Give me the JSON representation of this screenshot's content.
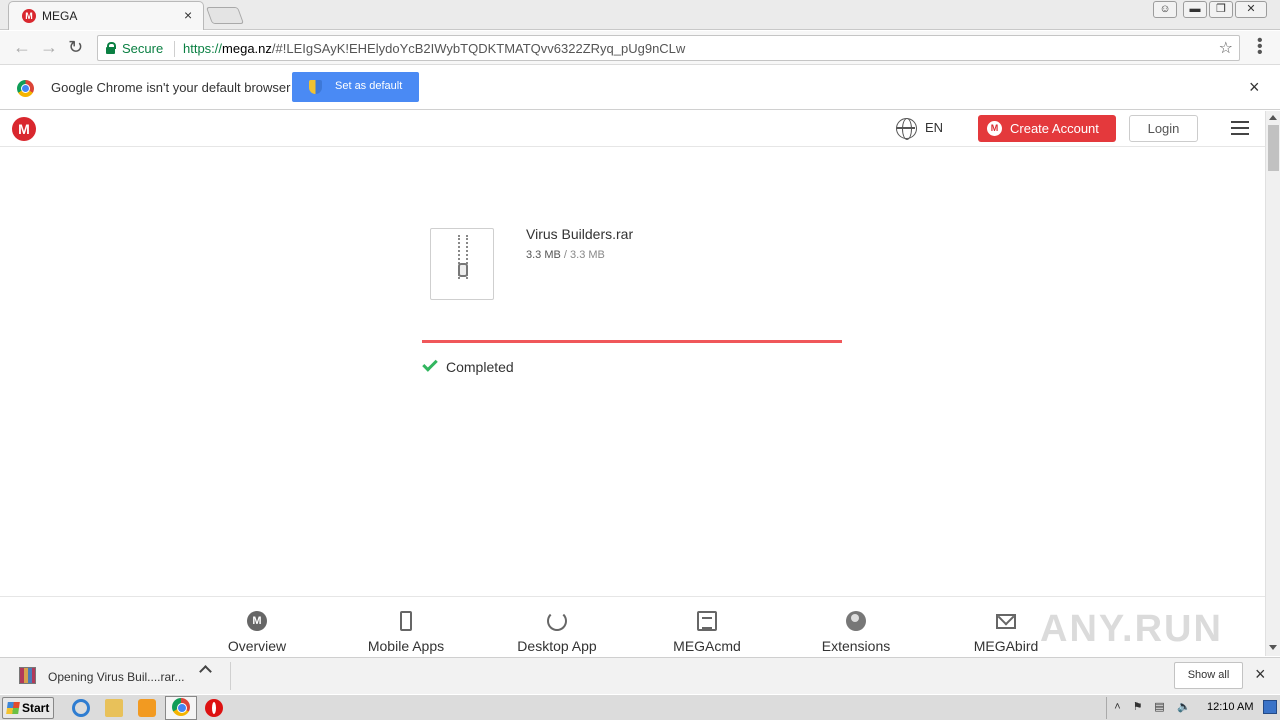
{
  "browser": {
    "tab_title": "MEGA",
    "tab_close": "×",
    "favicon_letter": "M",
    "secure_label": "Secure",
    "url_scheme": "https://",
    "url_host": "mega.nz",
    "url_rest": "/#!LEIgSAyK!EHElydoYcB2IWybTQDKTMATQvv6322ZRyq_pUg9nCLw",
    "window_controls": [
      "user",
      "minimize",
      "restore",
      "close"
    ]
  },
  "infobar": {
    "message": "Google Chrome isn't your default browser",
    "set_default_label": "Set as default",
    "close": "×"
  },
  "mega": {
    "logo_letter": "M",
    "language": "EN",
    "create_account_label": "Create Account",
    "login_label": "Login",
    "file": {
      "name": "Virus Builders.rar",
      "downloaded": "3.3 MB",
      "separator": "/",
      "total": "3.3 MB"
    },
    "progress_fraction": 1.0,
    "status": "Completed",
    "footer": [
      {
        "label": "Overview",
        "icon": "mega-circle-icon"
      },
      {
        "label": "Mobile Apps",
        "icon": "mobile-icon"
      },
      {
        "label": "Desktop App",
        "icon": "sync-icon"
      },
      {
        "label": "MEGAcmd",
        "icon": "terminal-icon"
      },
      {
        "label": "Extensions",
        "icon": "globe-icon"
      },
      {
        "label": "MEGAbird",
        "icon": "mail-icon"
      }
    ],
    "colors": {
      "brand": "#d9272e",
      "progress": "#f0575a",
      "success": "#32b65f"
    }
  },
  "watermark": "ANY.RUN",
  "download_shelf": {
    "item_name": "Opening Virus Buil....rar...",
    "show_all_label": "Show all",
    "close": "×"
  },
  "taskbar": {
    "start_label": "Start",
    "clock": "12:10 AM"
  }
}
